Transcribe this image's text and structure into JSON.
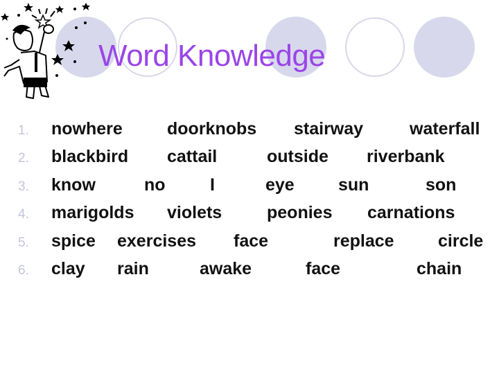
{
  "slide": {
    "title": "Word Knowledge",
    "colors": {
      "title": "#9a45e8",
      "circle_fill": "#d8d8ec",
      "circle_stroke": "#d8d8e8",
      "bullet": "#c4c4dc"
    },
    "illustration": "cartoon-man-catching-star",
    "rows": [
      {
        "number": "1.",
        "words": [
          "nowhere",
          "doorknobs",
          "stairway",
          "waterfall"
        ]
      },
      {
        "number": "2.",
        "words": [
          "blackbird",
          "cattail",
          "outside",
          "riverbank"
        ]
      },
      {
        "number": "3.",
        "words": [
          "know",
          "no",
          "I",
          "eye",
          "sun",
          "son"
        ]
      },
      {
        "number": "4.",
        "words": [
          "marigolds",
          "violets",
          "peonies",
          "carnations"
        ]
      },
      {
        "number": "5.",
        "words": [
          "spice",
          "exercises",
          "face",
          "replace",
          "circle"
        ]
      },
      {
        "number": "6.",
        "words": [
          "clay",
          "rain",
          "awake",
          "face",
          "chain"
        ]
      }
    ]
  }
}
